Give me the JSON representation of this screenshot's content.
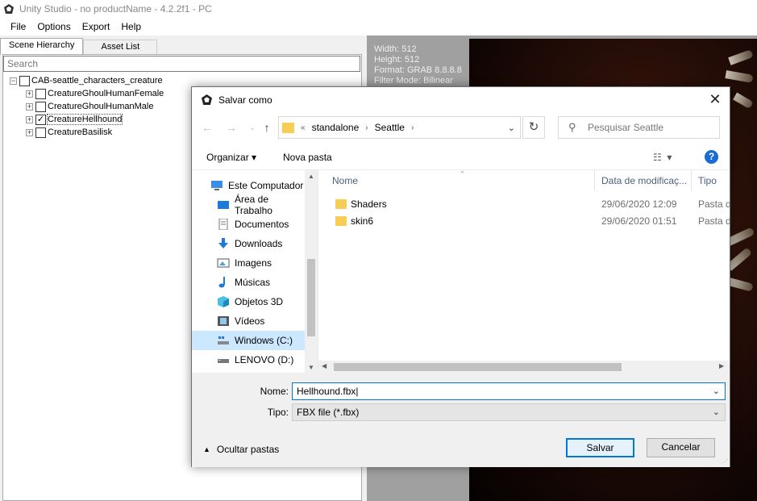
{
  "window": {
    "title": "Unity Studio - no productName - 4.2.2f1 - PC"
  },
  "menu": [
    "File",
    "Options",
    "Export",
    "Help"
  ],
  "tabs": {
    "scene_hierarchy": "Scene Hierarchy",
    "asset_list": "Asset List"
  },
  "search": {
    "placeholder": "Search"
  },
  "tree": {
    "root": {
      "label": "CAB-seattle_characters_creature",
      "expander": "−",
      "checked": false
    },
    "children": [
      {
        "label": "CreatureGhoulHumanFemale",
        "expander": "+",
        "checked": false
      },
      {
        "label": "CreatureGhoulHumanMale",
        "expander": "+",
        "checked": false
      },
      {
        "label": "CreatureHellhound",
        "expander": "+",
        "checked": true
      },
      {
        "label": "CreatureBasilisk",
        "expander": "+",
        "checked": false
      }
    ]
  },
  "preview": {
    "info_lines": [
      "Width: 512",
      "Height: 512",
      "Format: GRAB 8.8.8.8",
      "Filter Mode: Bilinear"
    ]
  },
  "dialog": {
    "title": "Salvar como",
    "address": {
      "overflow": "«",
      "crumbs": [
        "standalone",
        "Seattle"
      ]
    },
    "search_placeholder": "Pesquisar Seattle",
    "toolbar": {
      "organize": "Organizar ▾",
      "new_folder": "Nova pasta"
    },
    "nav_items": [
      {
        "label": "Este Computador",
        "icon": "computer-icon",
        "selected": false
      },
      {
        "label": "Área de Trabalho",
        "icon": "desktop-icon",
        "selected": false
      },
      {
        "label": "Documentos",
        "icon": "documents-icon",
        "selected": false
      },
      {
        "label": "Downloads",
        "icon": "downloads-icon",
        "selected": false
      },
      {
        "label": "Imagens",
        "icon": "pictures-icon",
        "selected": false
      },
      {
        "label": "Músicas",
        "icon": "music-icon",
        "selected": false
      },
      {
        "label": "Objetos 3D",
        "icon": "objects3d-icon",
        "selected": false
      },
      {
        "label": "Vídeos",
        "icon": "videos-icon",
        "selected": false
      },
      {
        "label": "Windows (C:)",
        "icon": "drive-c-icon",
        "selected": true
      },
      {
        "label": "LENOVO (D:)",
        "icon": "drive-d-icon",
        "selected": false
      }
    ],
    "columns": {
      "name": "Nome",
      "date": "Data de modificaç...",
      "type": "Tipo"
    },
    "files": [
      {
        "name": "Shaders",
        "date": "29/06/2020 12:09",
        "type": "Pasta d"
      },
      {
        "name": "skin6",
        "date": "29/06/2020 01:51",
        "type": "Pasta d"
      }
    ],
    "name_label": "Nome:",
    "name_value": "Hellhound.fbx",
    "type_label": "Tipo:",
    "type_value": "FBX file (*.fbx)",
    "hide_folders": "Ocultar pastas",
    "save_button": "Salvar",
    "cancel_button": "Cancelar"
  },
  "colors": {
    "accent": "#0078d7",
    "selection": "#cce8ff",
    "folder": "#f6cd55",
    "help": "#1a6ad2"
  }
}
